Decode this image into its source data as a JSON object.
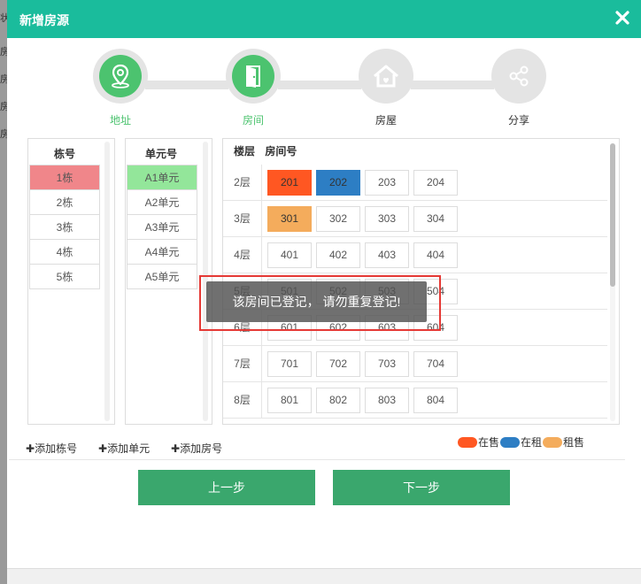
{
  "background": {
    "fragments": [
      "状",
      "房",
      "房",
      "房",
      "房"
    ]
  },
  "dialog": {
    "title": "新增房源"
  },
  "steps": [
    {
      "label": "地址",
      "icon": "location-pin-icon",
      "active": true
    },
    {
      "label": "房间",
      "icon": "door-icon",
      "active": true
    },
    {
      "label": "房屋",
      "icon": "house-icon",
      "active": false
    },
    {
      "label": "分享",
      "icon": "share-icon",
      "active": false
    }
  ],
  "buildings": {
    "header": "栋号",
    "items": [
      "1栋",
      "2栋",
      "3栋",
      "4栋",
      "5栋"
    ],
    "selected": 0
  },
  "units": {
    "header": "单元号",
    "items": [
      "A1单元",
      "A2单元",
      "A3单元",
      "A4单元",
      "A5单元"
    ],
    "selected": 0
  },
  "rooms": {
    "floor_header": "楼层",
    "room_header": "房间号",
    "rows": [
      {
        "floor": "2层",
        "rooms": [
          "201",
          "202",
          "203",
          "204"
        ]
      },
      {
        "floor": "3层",
        "rooms": [
          "301",
          "302",
          "303",
          "304"
        ]
      },
      {
        "floor": "4层",
        "rooms": [
          "401",
          "402",
          "403",
          "404"
        ]
      },
      {
        "floor": "5层",
        "rooms": [
          "501",
          "502",
          "503",
          "504"
        ]
      },
      {
        "floor": "6层",
        "rooms": [
          "601",
          "602",
          "603",
          "604"
        ]
      },
      {
        "floor": "7层",
        "rooms": [
          "701",
          "702",
          "703",
          "704"
        ]
      },
      {
        "floor": "8层",
        "rooms": [
          "801",
          "802",
          "803",
          "804"
        ]
      }
    ],
    "status": {
      "201": "sale",
      "202": "rent",
      "301": "rentsale"
    }
  },
  "toast": {
    "message": "该房间已登记， 请勿重复登记!"
  },
  "actions": {
    "add_building": "添加栋号",
    "add_unit": "添加单元",
    "add_room": "添加房号"
  },
  "legend": [
    {
      "label": "在售",
      "color": "#ff5722"
    },
    {
      "label": "在租",
      "color": "#2d7ec4"
    },
    {
      "label": "租售",
      "color": "#f4ac5c"
    }
  ],
  "buttons": {
    "prev": "上一步",
    "next": "下一步"
  }
}
